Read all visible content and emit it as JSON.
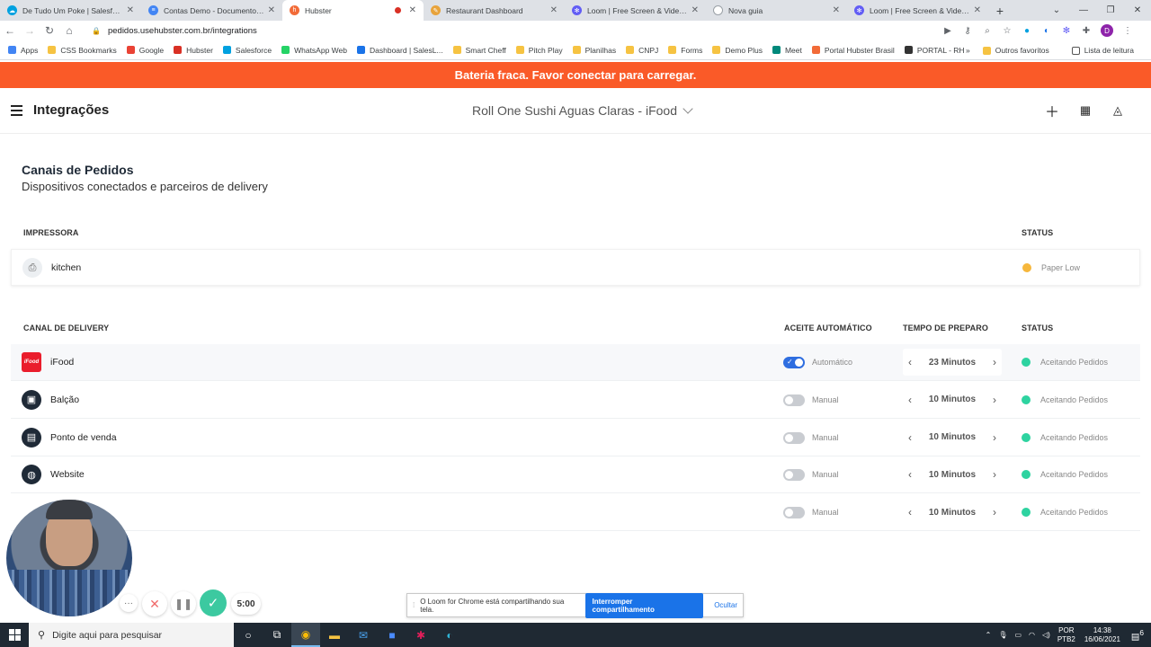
{
  "browser": {
    "tabs": [
      {
        "title": "De Tudo Um Poke | Salesforce",
        "color": "#00a1e0",
        "glyph": "☁",
        "active": false
      },
      {
        "title": "Contas Demo - Documentos Go",
        "color": "#4285f4",
        "glyph": "≡",
        "active": false
      },
      {
        "title": "Hubster",
        "color": "#f26b38",
        "glyph": "h",
        "active": true
      },
      {
        "title": "Restaurant Dashboard",
        "color": "#e8a33b",
        "glyph": "✎",
        "active": false
      },
      {
        "title": "Loom | Free Screen & Video Rec",
        "color": "#625df5",
        "glyph": "✻",
        "active": false
      },
      {
        "title": "Nova guia",
        "color": "#ffffff",
        "glyph": "",
        "active": false
      },
      {
        "title": "Loom | Free Screen & Video Rec",
        "color": "#625df5",
        "glyph": "✻",
        "active": false
      }
    ],
    "url": "pedidos.usehubster.com.br/integrations",
    "profile_initial": "D",
    "bookmarks": [
      {
        "label": "Apps",
        "color": "#4285f4"
      },
      {
        "label": "CSS Bookmarks",
        "color": "#f6c342"
      },
      {
        "label": "Google",
        "color": "#ea4335"
      },
      {
        "label": "Hubster",
        "color": "#d93025"
      },
      {
        "label": "Salesforce",
        "color": "#00a1e0"
      },
      {
        "label": "WhatsApp Web",
        "color": "#25d366"
      },
      {
        "label": "Dashboard | SalesL...",
        "color": "#1a73e8"
      },
      {
        "label": "Smart Cheff",
        "color": "#f6c342"
      },
      {
        "label": "Pitch Play",
        "color": "#f6c342"
      },
      {
        "label": "Planilhas",
        "color": "#f6c342"
      },
      {
        "label": "CNPJ",
        "color": "#f6c342"
      },
      {
        "label": "Forms",
        "color": "#f6c342"
      },
      {
        "label": "Demo Plus",
        "color": "#f6c342"
      },
      {
        "label": "Meet",
        "color": "#00897b"
      },
      {
        "label": "Portal Hubster Brasil",
        "color": "#f26b38"
      },
      {
        "label": "PORTAL - RH",
        "color": "#333333"
      }
    ],
    "bookmarks_more": "»",
    "other_favorites": "Outros favoritos",
    "reading_list": "Lista de leitura"
  },
  "banner": {
    "text": "Bateria fraca. Favor conectar para carregar.",
    "color": "#fa5a28"
  },
  "header": {
    "title": "Integrações",
    "store": "Roll One Sushi Aguas Claras - iFood"
  },
  "section": {
    "title": "Canais de Pedidos",
    "subtitle": "Dispositivos conectados e parceiros de delivery"
  },
  "printers": {
    "col_name": "IMPRESSORA",
    "col_status": "STATUS",
    "rows": [
      {
        "name": "kitchen",
        "status": "Paper Low",
        "status_color": "#f6b73c"
      }
    ]
  },
  "delivery": {
    "col_channel": "CANAL DE DELIVERY",
    "col_auto": "ACEITE AUTOMÁTICO",
    "col_prep": "TEMPO DE PREPARO",
    "col_status": "STATUS",
    "rows": [
      {
        "name": "iFood",
        "icon": "ifood-logo-icon",
        "icon_bg": "#ea1d2c",
        "icon_glyph": "iFood",
        "auto": true,
        "mode": "Automático",
        "prep": "23 Minutos",
        "status": "Aceitando Pedidos"
      },
      {
        "name": "Balção",
        "icon": "counter-icon",
        "icon_bg": "#1f2a37",
        "icon_glyph": "▣",
        "auto": false,
        "mode": "Manual",
        "prep": "10 Minutos",
        "status": "Aceitando Pedidos"
      },
      {
        "name": "Ponto de venda",
        "icon": "pos-terminal-icon",
        "icon_bg": "#1f2a37",
        "icon_glyph": "▤",
        "auto": false,
        "mode": "Manual",
        "prep": "10 Minutos",
        "status": "Aceitando Pedidos"
      },
      {
        "name": "Website",
        "icon": "globe-icon",
        "icon_bg": "#1f2a37",
        "icon_glyph": "◍",
        "auto": false,
        "mode": "Manual",
        "prep": "10 Minutos",
        "status": "Aceitando Pedidos"
      },
      {
        "name": "",
        "icon": "channel-icon",
        "icon_bg": "#ffffff",
        "icon_glyph": "",
        "auto": false,
        "mode": "Manual",
        "prep": "10 Minutos",
        "status": "Aceitando Pedidos"
      }
    ],
    "status_color": "#2ed3a0"
  },
  "loom": {
    "timer": "5:00",
    "share_message": "O Loom for Chrome está compartilhando sua tela.",
    "stop_label": "Interromper compartilhamento",
    "hide_label": "Ocultar"
  },
  "taskbar": {
    "search_placeholder": "Digite aqui para pesquisar",
    "lang_top": "POR",
    "lang_bottom": "PTB2",
    "time": "14:38",
    "date": "16/06/2021",
    "notifications": "6"
  }
}
